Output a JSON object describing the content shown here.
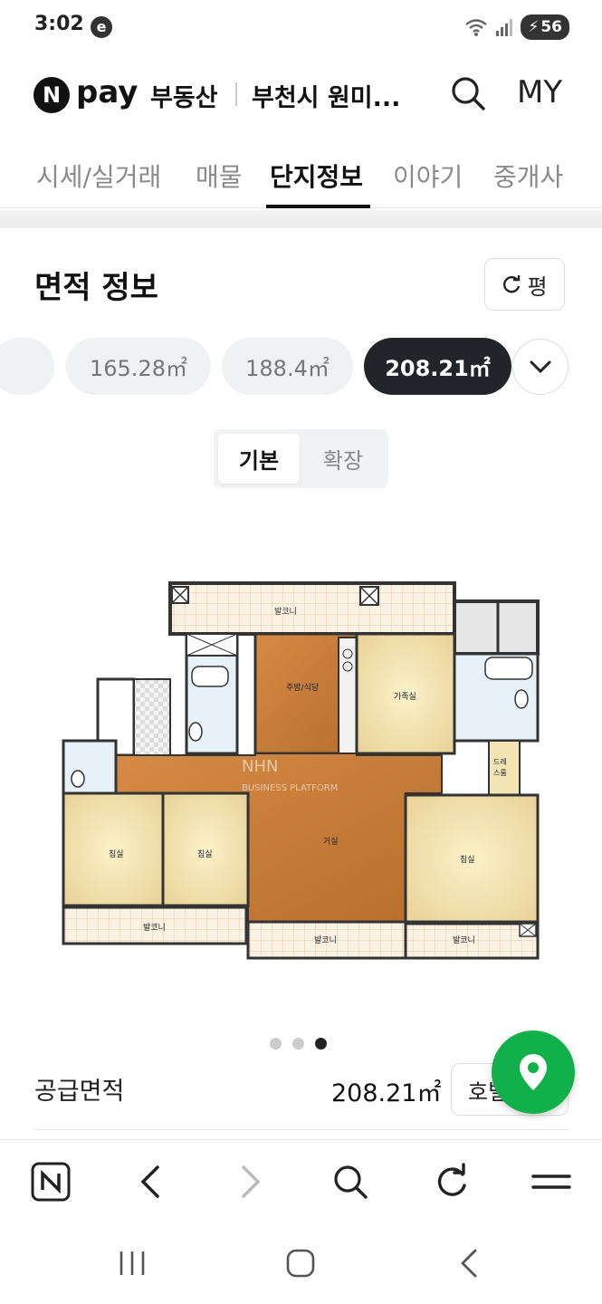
{
  "status": {
    "time": "3:02",
    "app_icon": "e",
    "battery": "56"
  },
  "header": {
    "logo_letter": "N",
    "logo_pay": "pay",
    "service": "부동산",
    "location": "부천시 원미...",
    "my_label": "MY"
  },
  "tabs": [
    {
      "label": "시세/실거래"
    },
    {
      "label": "매물"
    },
    {
      "label": "단지정보",
      "active": true
    },
    {
      "label": "이야기"
    },
    {
      "label": "중개사"
    }
  ],
  "section": {
    "title": "면적 정보",
    "unit_toggle_label": "평"
  },
  "area_chips": [
    {
      "label": "165.28㎡",
      "selected": false
    },
    {
      "label": "188.4㎡",
      "selected": false
    },
    {
      "label": "208.21㎡",
      "selected": true
    }
  ],
  "view_toggle": {
    "basic": "기본",
    "expanded": "확장",
    "selected": "basic"
  },
  "floorplan": {
    "watermark_top": "NHN",
    "watermark_bottom": "BUSINESS PLATFORM",
    "rooms": {
      "balcony": "발코니",
      "kitchen": "주방/식당",
      "family": "가족실",
      "living": "거실",
      "bedroom": "침실",
      "dress1": "드레",
      "dress2": "스룸"
    }
  },
  "carousel": {
    "count": 3,
    "active": 3
  },
  "supply_area": {
    "label": "공급면적",
    "value": "208.21㎡",
    "button": "호별"
  },
  "colors": {
    "accent": "#12b04a",
    "dark_chip": "#212529",
    "floor_wood": "#c97e3a"
  }
}
